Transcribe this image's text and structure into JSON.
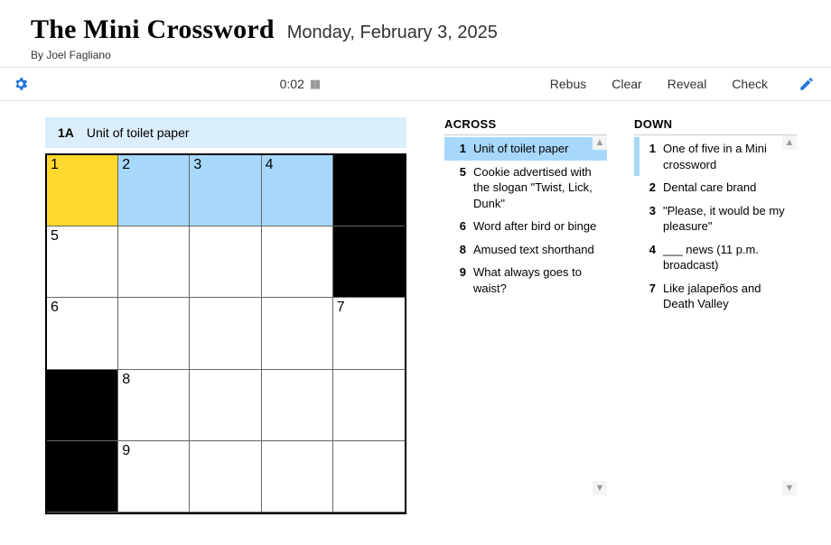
{
  "header": {
    "title": "The Mini Crossword",
    "date": "Monday, February 3, 2025",
    "byline": "By Joel Fagliano"
  },
  "toolbar": {
    "timer": "0:02",
    "rebus": "Rebus",
    "clear": "Clear",
    "reveal": "Reveal",
    "check": "Check"
  },
  "current_clue": {
    "label": "1A",
    "text": "Unit of toilet paper"
  },
  "grid": {
    "size": 5,
    "cells": [
      {
        "black": false,
        "num": "1",
        "state": "focus"
      },
      {
        "black": false,
        "num": "2",
        "state": "hl"
      },
      {
        "black": false,
        "num": "3",
        "state": "hl"
      },
      {
        "black": false,
        "num": "4",
        "state": "hl"
      },
      {
        "black": true
      },
      {
        "black": false,
        "num": "5"
      },
      {
        "black": false
      },
      {
        "black": false
      },
      {
        "black": false
      },
      {
        "black": true
      },
      {
        "black": false,
        "num": "6"
      },
      {
        "black": false
      },
      {
        "black": false
      },
      {
        "black": false
      },
      {
        "black": false,
        "num": "7"
      },
      {
        "black": true
      },
      {
        "black": false,
        "num": "8"
      },
      {
        "black": false
      },
      {
        "black": false
      },
      {
        "black": false
      },
      {
        "black": true
      },
      {
        "black": false,
        "num": "9"
      },
      {
        "black": false
      },
      {
        "black": false
      },
      {
        "black": false
      }
    ]
  },
  "lists": {
    "across": {
      "title": "ACROSS",
      "clues": [
        {
          "num": "1",
          "text": "Unit of toilet paper",
          "selected": true
        },
        {
          "num": "5",
          "text": "Cookie advertised with the slogan \"Twist, Lick, Dunk\""
        },
        {
          "num": "6",
          "text": "Word after bird or binge"
        },
        {
          "num": "8",
          "text": "Amused text shorthand"
        },
        {
          "num": "9",
          "text": "What always goes to waist?"
        }
      ]
    },
    "down": {
      "title": "DOWN",
      "clues": [
        {
          "num": "1",
          "text": "One of five in a Mini crossword",
          "related": true
        },
        {
          "num": "2",
          "text": "Dental care brand"
        },
        {
          "num": "3",
          "text": "\"Please, it would be my pleasure\""
        },
        {
          "num": "4",
          "text": "___ news (11 p.m. broadcast)"
        },
        {
          "num": "7",
          "text": "Like jalapeños and Death Valley"
        }
      ]
    }
  }
}
